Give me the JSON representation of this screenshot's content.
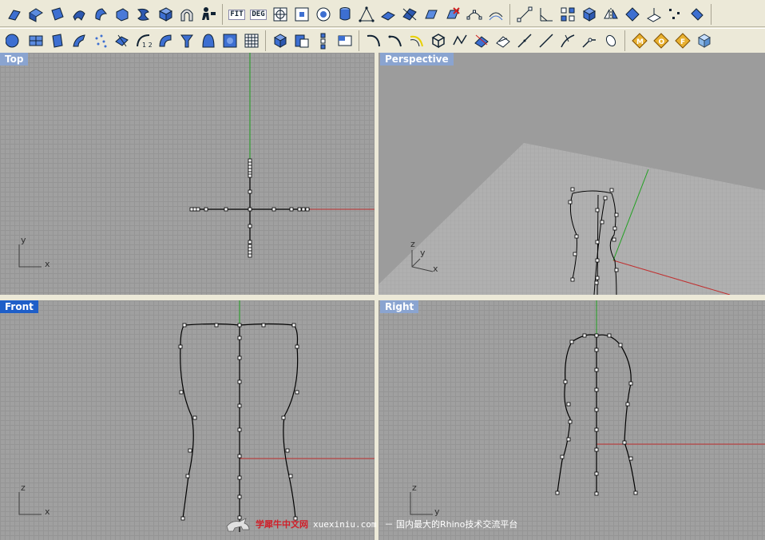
{
  "toolbar_top": {
    "fit_label": "FIT",
    "deg_label": "DEG"
  },
  "viewports": {
    "top": {
      "title": "Top",
      "axis_v": "y",
      "axis_h": "x"
    },
    "perspective": {
      "title": "Perspective",
      "axis_v": "z",
      "axis_y": "y",
      "axis_h": "x"
    },
    "front": {
      "title": "Front",
      "axis_v": "z",
      "axis_h": "x"
    },
    "right": {
      "title": "Right",
      "axis_v": "z",
      "axis_h": "y"
    }
  },
  "watermark": {
    "brand": "学犀牛中文网",
    "url": "xuexiniu.com",
    "tagline": "－ 国内最大的Rhino技术交流平台"
  },
  "colors": {
    "x_axis": "#c03030",
    "y_axis": "#20a020",
    "active_title": "#1e5ec8",
    "inactive_title": "#8aa4d0",
    "grid": "#959595",
    "viewport_bg": "#a0a0a0"
  }
}
